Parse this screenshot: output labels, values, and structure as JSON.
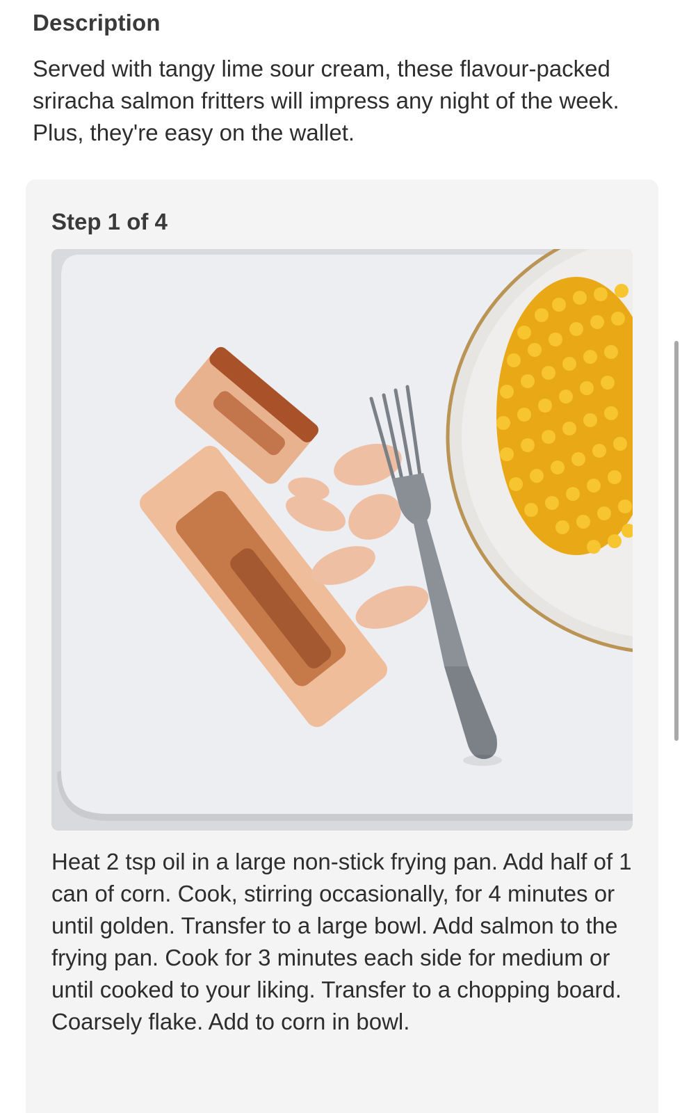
{
  "description": {
    "heading": "Description",
    "text": "Served with tangy lime sour cream, these flavour-packed sriracha salmon fritters will impress any night of the week. Plus, they're easy on the wallet."
  },
  "step": {
    "label": "Step 1 of 4",
    "image_alt": "Cooked salmon fillets being flaked with a fork beside a plate of golden corn",
    "text": "Heat 2 tsp oil in a large non-stick frying pan. Add half of 1 can of corn. Cook, stirring occasionally, for 4 minutes or until golden. Transfer to a large bowl. Add salmon to the frying pan. Cook for 3 minutes each side for medium or until cooked to your liking. Transfer to a chopping board. Coarsely flake. Add to corn in bowl."
  },
  "colors": {
    "card_background": "#f4f4f4",
    "text": "#2d2d2d",
    "scrollbar": "#a9a9a9"
  }
}
